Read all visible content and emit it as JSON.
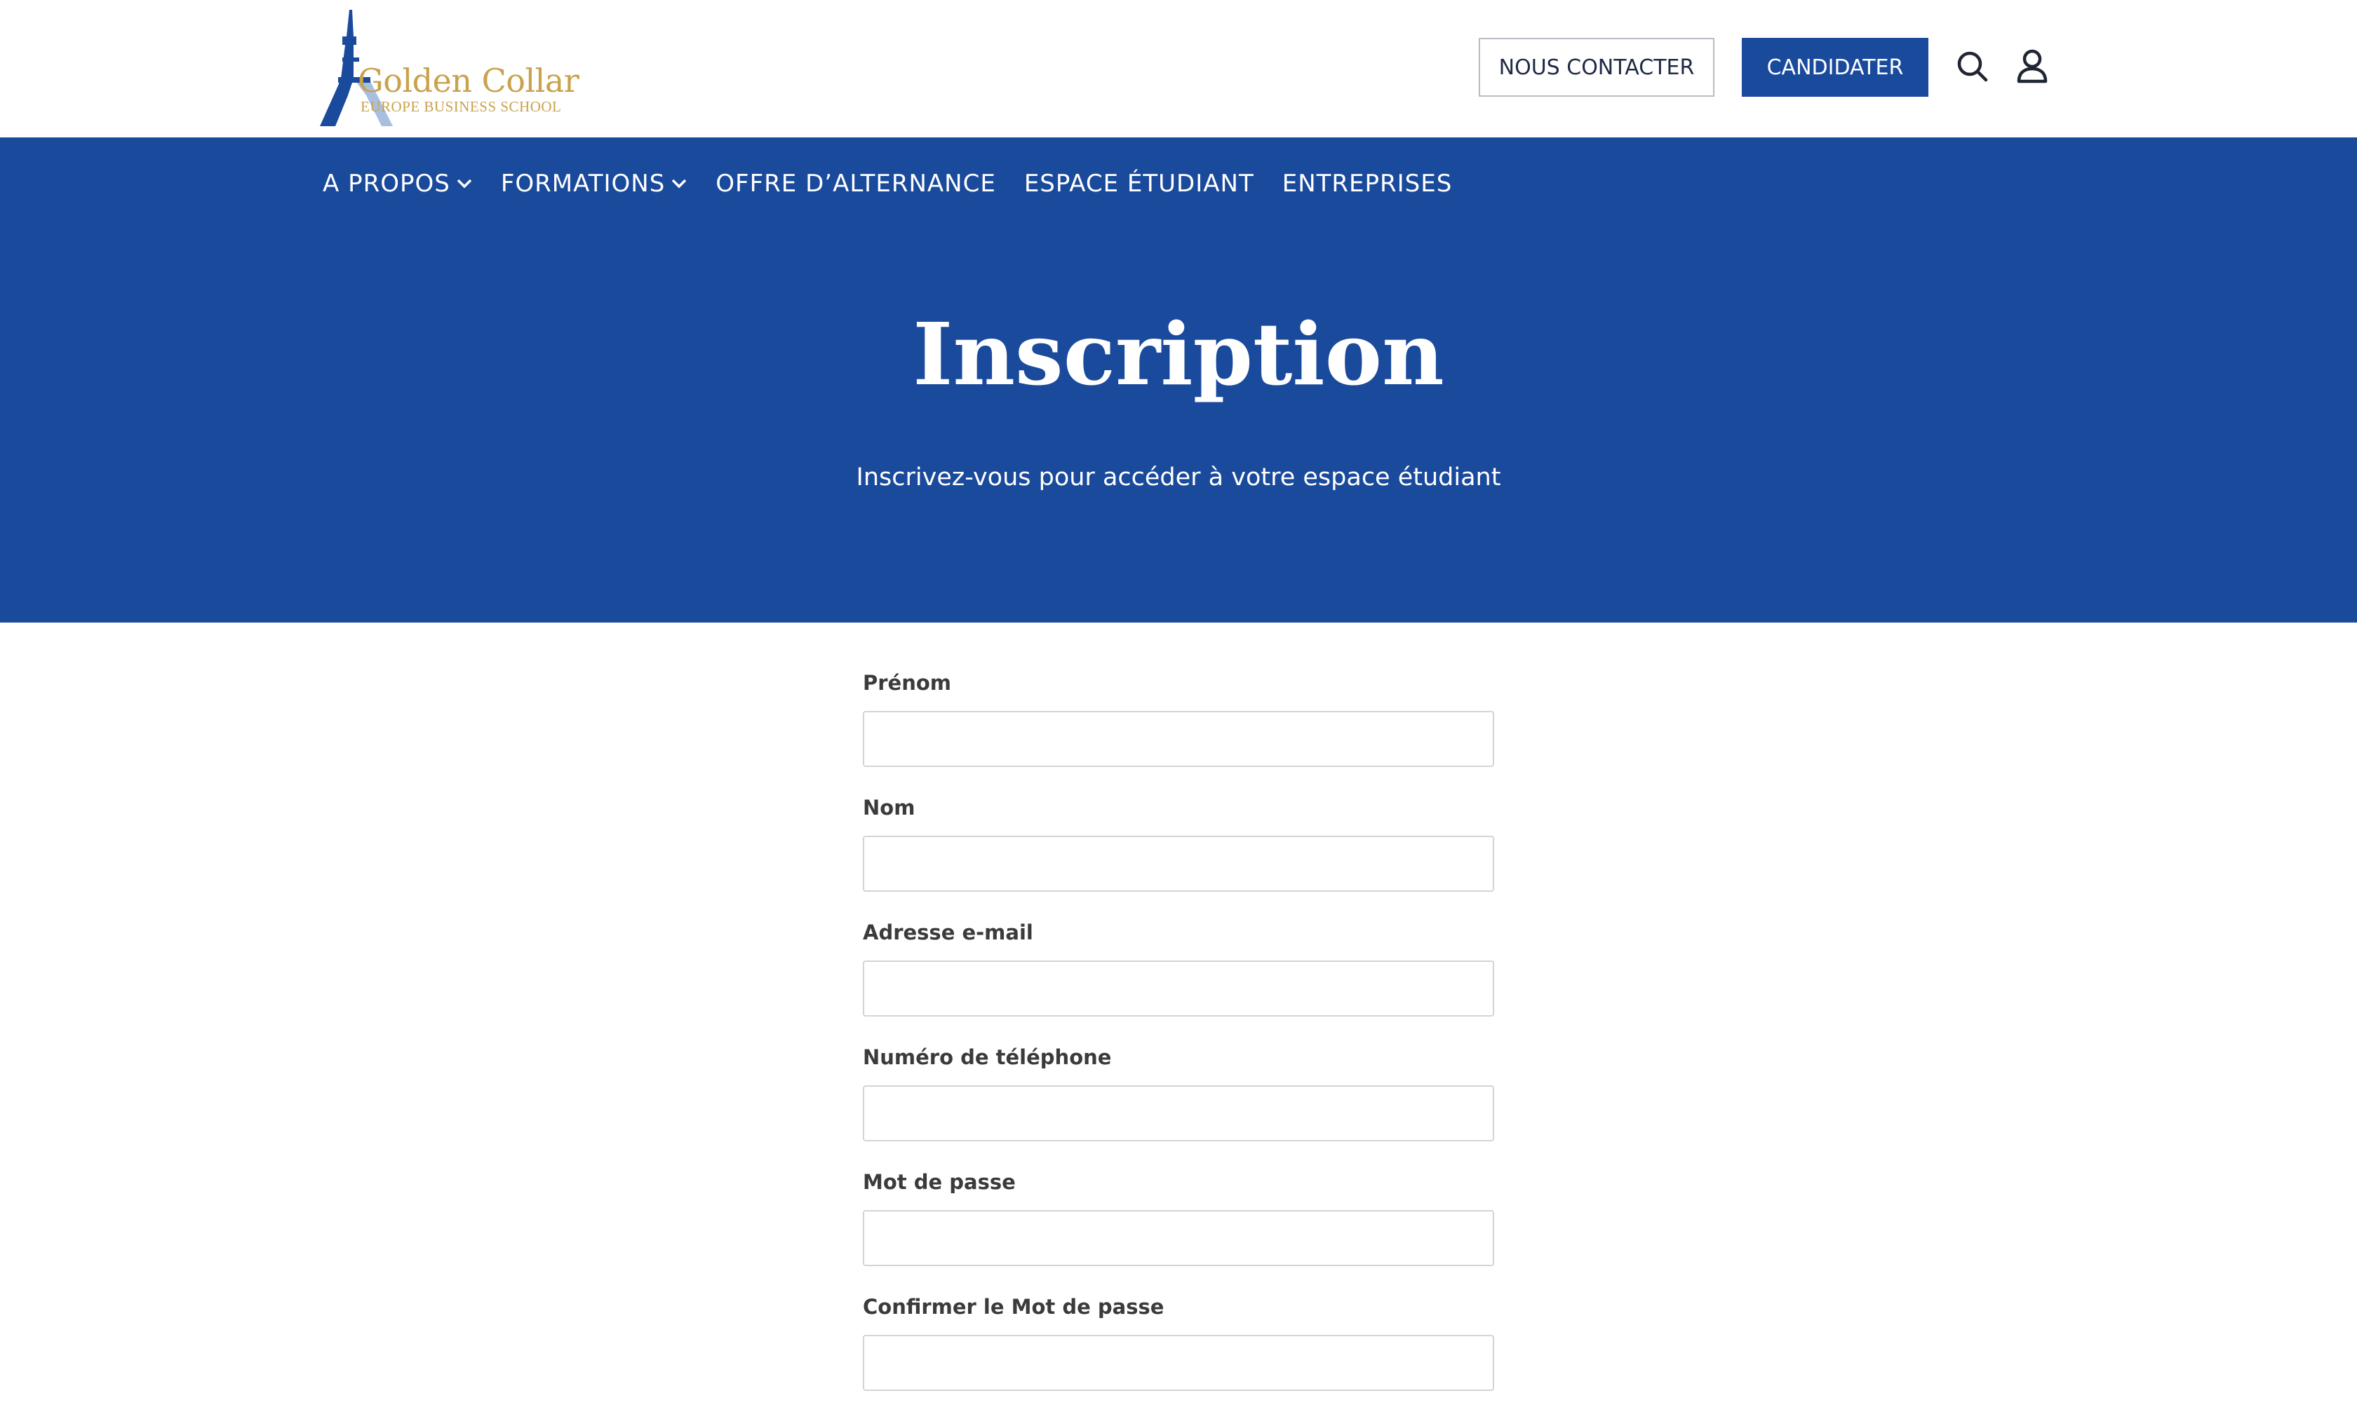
{
  "header": {
    "logo": {
      "name": "Golden Collar",
      "tagline": "EUROPE BUSINESS SCHOOL",
      "colors": {
        "gold": "#c9a24c",
        "blue": "#1a4a9c",
        "light_blue": "#a9bfe0"
      }
    },
    "contact_button": "NOUS CONTACTER",
    "apply_button": "CANDIDATER",
    "icons": [
      "search-icon",
      "user-icon"
    ]
  },
  "nav": {
    "items": [
      {
        "label": "A PROPOS",
        "dropdown": true
      },
      {
        "label": "FORMATIONS",
        "dropdown": true
      },
      {
        "label": "OFFRE D’ALTERNANCE",
        "dropdown": false
      },
      {
        "label": "ESPACE ÉTUDIANT",
        "dropdown": false
      },
      {
        "label": "ENTREPRISES",
        "dropdown": false
      }
    ]
  },
  "hero": {
    "title": "Inscription",
    "subtitle": "Inscrivez-vous pour accéder à votre espace étudiant",
    "background": "#1a4a9c"
  },
  "form": {
    "fields": [
      {
        "label": "Prénom",
        "value": "",
        "placeholder": ""
      },
      {
        "label": "Nom",
        "value": "",
        "placeholder": ""
      },
      {
        "label": "Adresse e-mail",
        "value": "",
        "placeholder": ""
      },
      {
        "label": "Numéro de téléphone",
        "value": "",
        "placeholder": ""
      },
      {
        "label": "Mot de passe",
        "value": "",
        "placeholder": ""
      },
      {
        "label": "Confirmer le Mot de passe",
        "value": "",
        "placeholder": ""
      }
    ]
  }
}
